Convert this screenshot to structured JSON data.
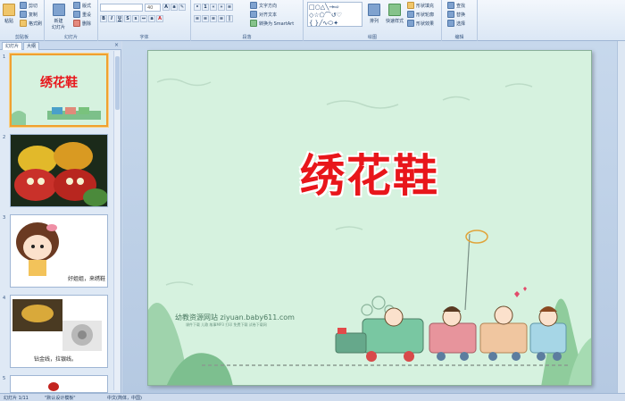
{
  "ribbon": {
    "clipboard": {
      "paste": "粘贴",
      "cut": "剪切",
      "copy": "复制",
      "format_painter": "格式刷",
      "label": "剪贴板"
    },
    "slides": {
      "new_slide": "新建\n幻灯片",
      "layout": "版式",
      "reset": "重设",
      "delete": "删除",
      "label": "幻灯片"
    },
    "font": {
      "font_name": "",
      "font_size": "40",
      "label": "字体"
    },
    "paragraph": {
      "text_direction": "文字方向",
      "align_text": "对齐文本",
      "smartart": "转换为 SmartArt",
      "label": "段落"
    },
    "drawing": {
      "arrange": "排列",
      "quick_styles": "快速样式",
      "shape_fill": "形状填充",
      "shape_outline": "形状轮廓",
      "shape_effects": "形状效果",
      "label": "绘图"
    },
    "editing": {
      "find": "查找",
      "replace": "替换",
      "select": "选择",
      "label": "编辑"
    }
  },
  "left_pane": {
    "tab_slides": "幻灯片",
    "tab_outline": "大纲",
    "close": "×",
    "thumbs": [
      {
        "num": "1",
        "title": "绣花鞋"
      },
      {
        "num": "2",
        "title": ""
      },
      {
        "num": "3",
        "caption": "好姐姐，来绣鞋"
      },
      {
        "num": "4",
        "caption": "钻金线，拉银线。"
      },
      {
        "num": "5",
        "caption": ""
      }
    ]
  },
  "slide": {
    "title": "绣花鞋",
    "watermark": "幼教资源网站  ziyuan.baby611.com",
    "watermark_sub": "课件下载  儿歌  故事MP3  打印 免费下载  试卷下载网"
  },
  "status": {
    "slide_pos": "幻灯片 1/11",
    "theme": "\"默认设计模板\"",
    "language": "中文(简体，中国)"
  },
  "colors": {
    "title_red": "#e8161b",
    "slide_bg": "#d6f2df",
    "selection": "#f0a030"
  }
}
